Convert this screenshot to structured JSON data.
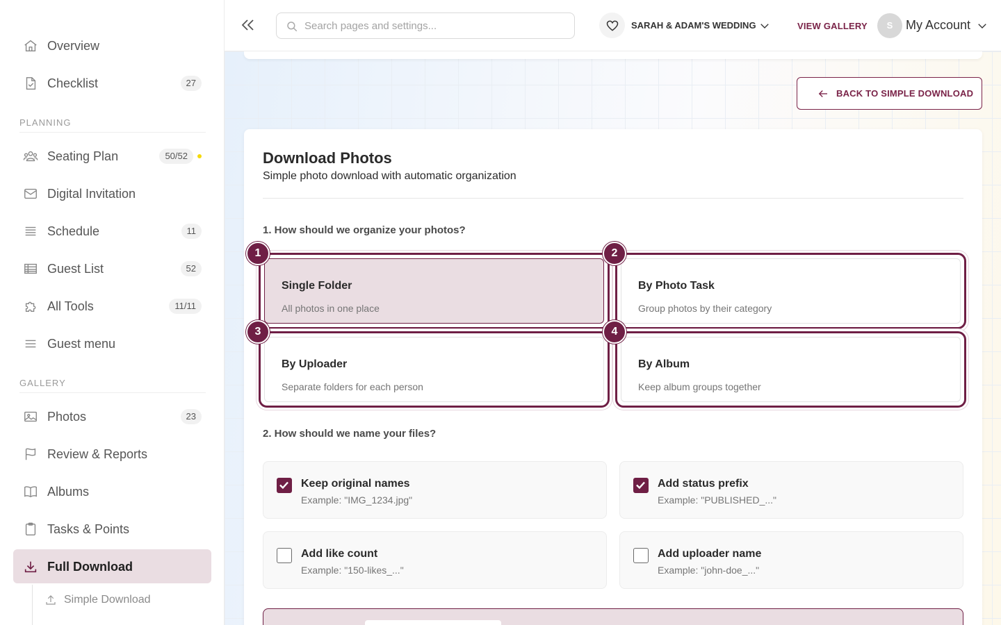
{
  "sidebar": {
    "items": [
      {
        "label": "Overview",
        "badge": "",
        "icon": "home-icon"
      },
      {
        "label": "Checklist",
        "badge": "27",
        "icon": "checklist-icon"
      },
      {
        "label": "Seating Plan",
        "badge": "50/52",
        "icon": "people-icon"
      },
      {
        "label": "Digital Invitation",
        "badge": "",
        "icon": "mail-icon"
      },
      {
        "label": "Schedule",
        "badge": "11",
        "icon": "list-icon"
      },
      {
        "label": "Guest List",
        "badge": "52",
        "icon": "table-icon"
      },
      {
        "label": "All Tools",
        "badge": "11/11",
        "icon": "puzzle-icon"
      },
      {
        "label": "Guest menu",
        "badge": "",
        "icon": "menu-icon"
      },
      {
        "label": "Photos",
        "badge": "23",
        "icon": "image-icon"
      },
      {
        "label": "Review & Reports",
        "badge": "",
        "icon": "flag-icon"
      },
      {
        "label": "Albums",
        "badge": "",
        "icon": "book-icon"
      },
      {
        "label": "Tasks & Points",
        "badge": "",
        "icon": "clipboard-icon"
      },
      {
        "label": "Full Download",
        "badge": "",
        "icon": "download-icon"
      }
    ],
    "sections": {
      "planning": "PLANNING",
      "gallery": "GALLERY"
    },
    "sub_item": {
      "label": "Simple Download",
      "icon": "upload-icon"
    },
    "status_dot_color": "#f5d90a"
  },
  "header": {
    "search_placeholder": "Search pages and settings...",
    "event_name": "SARAH & ADAM'S WEDDING",
    "view_gallery": "VIEW GALLERY",
    "avatar_initial": "S",
    "account_label": "My Account"
  },
  "main": {
    "back_button": "BACK TO SIMPLE DOWNLOAD",
    "title": "Download Photos",
    "subtitle": "Simple photo download with automatic organization",
    "q1": "1. How should we organize your photos?",
    "options": [
      {
        "num": "1",
        "title": "Single Folder",
        "desc": "All photos in one place",
        "selected": true
      },
      {
        "num": "2",
        "title": "By Photo Task",
        "desc": "Group photos by their category",
        "selected": false
      },
      {
        "num": "3",
        "title": "By Uploader",
        "desc": "Separate folders for each person",
        "selected": false
      },
      {
        "num": "4",
        "title": "By Album",
        "desc": "Keep album groups together",
        "selected": false
      }
    ],
    "q2": "2. How should we name your files?",
    "checks": [
      {
        "title": "Keep original names",
        "example": "Example: \"IMG_1234.jpg\"",
        "checked": true
      },
      {
        "title": "Add status prefix",
        "example": "Example: \"PUBLISHED_...\"",
        "checked": true
      },
      {
        "title": "Add like count",
        "example": "Example: \"150-likes_...\"",
        "checked": false
      },
      {
        "title": "Add uploader name",
        "example": "Example: \"john-doe_...\"",
        "checked": false
      }
    ]
  },
  "colors": {
    "accent": "#6f1f45",
    "accent_soft": "#eadde2"
  }
}
